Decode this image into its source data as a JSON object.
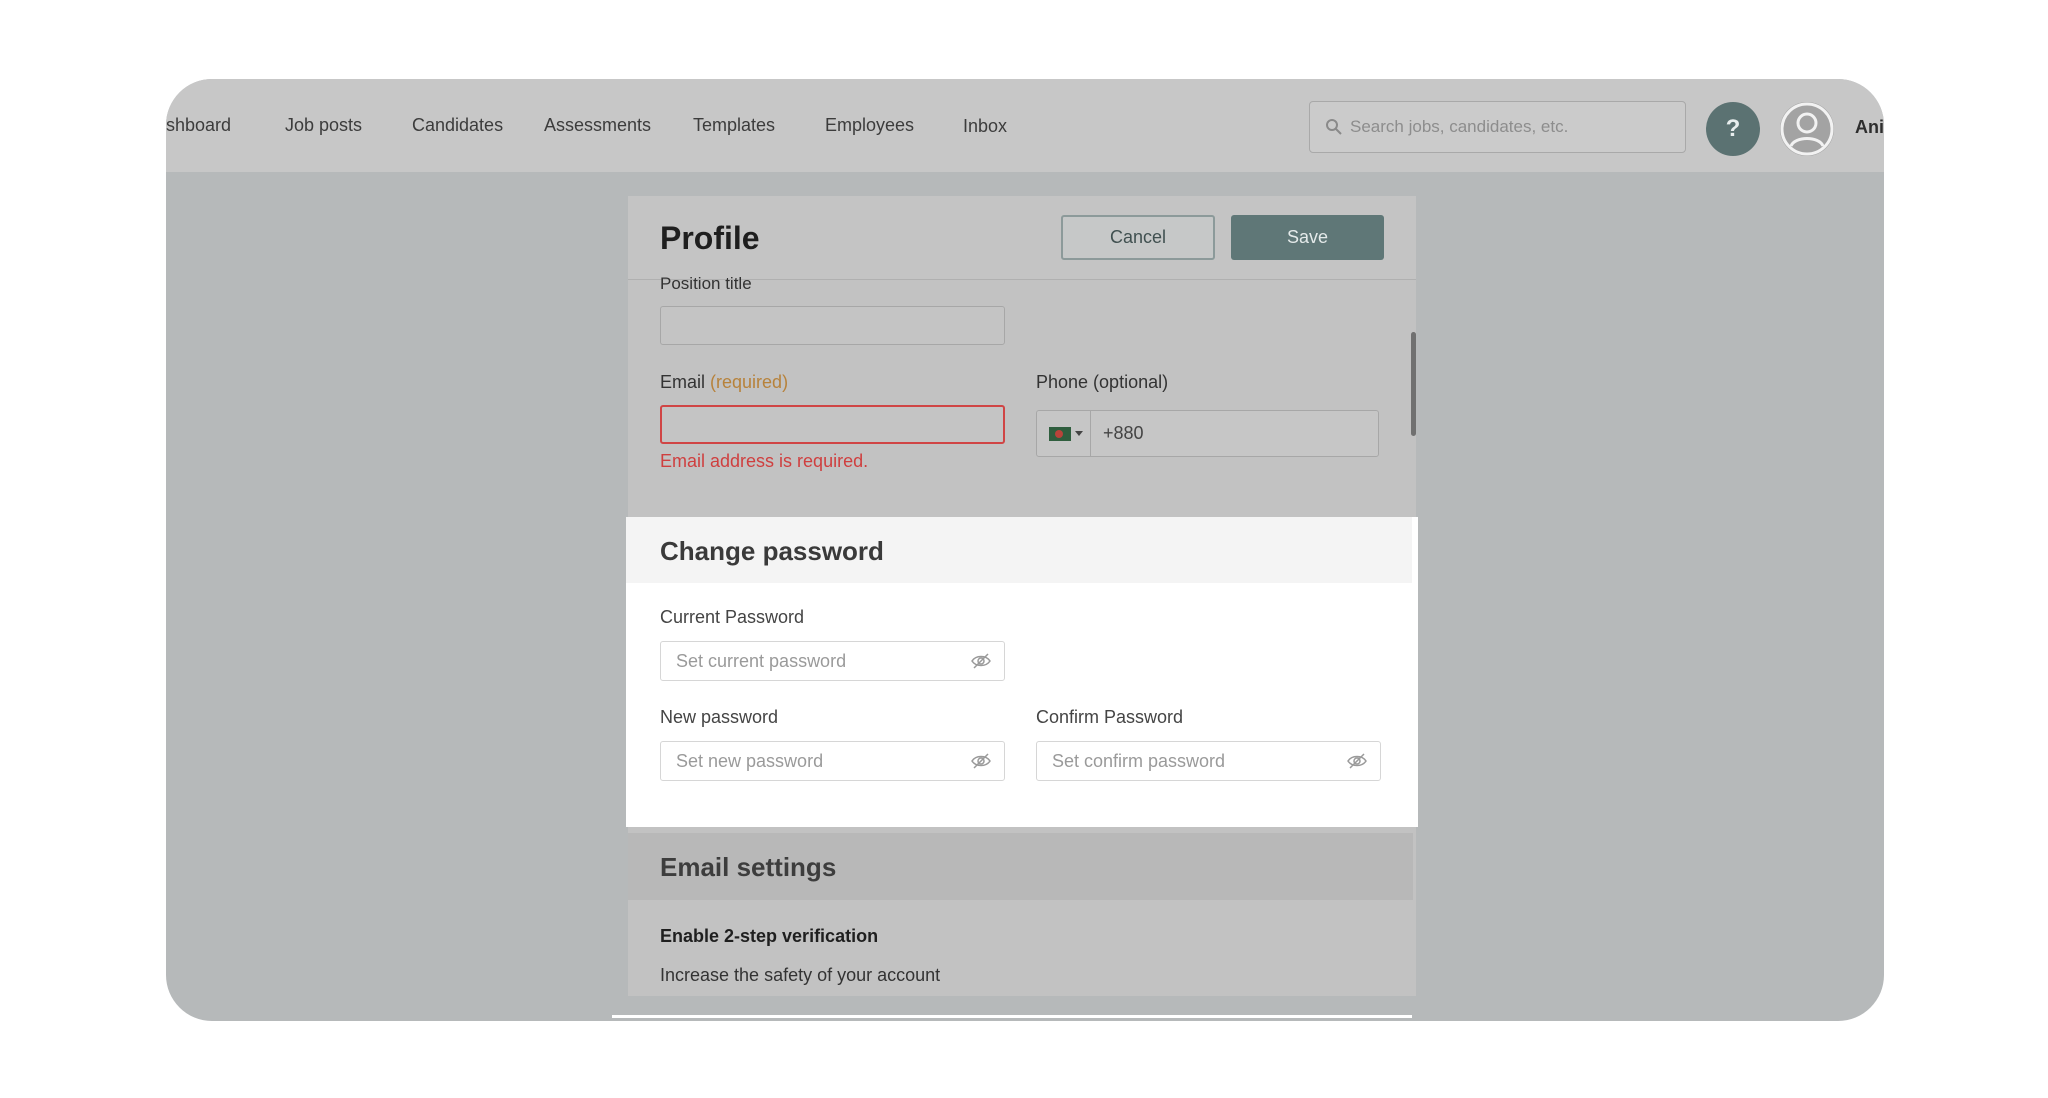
{
  "nav": {
    "items": [
      "shboard",
      "Job posts",
      "Candidates",
      "Assessments",
      "Templates",
      "Employees",
      "Inbox"
    ],
    "search_placeholder": "Search jobs, candidates, etc.",
    "help_label": "?",
    "user_name": "Ani"
  },
  "profile": {
    "title": "Profile",
    "cancel_label": "Cancel",
    "save_label": "Save",
    "position_label": "Position title",
    "position_value": "",
    "email_label": "Email",
    "email_required": "(required)",
    "email_value": "",
    "email_error": "Email address is required.",
    "phone_label": "Phone (optional)",
    "phone_code": "+880"
  },
  "change_password": {
    "title": "Change password",
    "current_label": "Current Password",
    "current_placeholder": "Set current password",
    "new_label": "New password",
    "new_placeholder": "Set new password",
    "confirm_label": "Confirm Password",
    "confirm_placeholder": "Set confirm password"
  },
  "email_settings": {
    "title": "Email settings",
    "two_step_label": "Enable 2-step verification",
    "two_step_desc": "Increase the safety of your account"
  },
  "colors": {
    "primary": "#5f7777",
    "error": "#cf3f3f",
    "required": "#b7823b"
  }
}
